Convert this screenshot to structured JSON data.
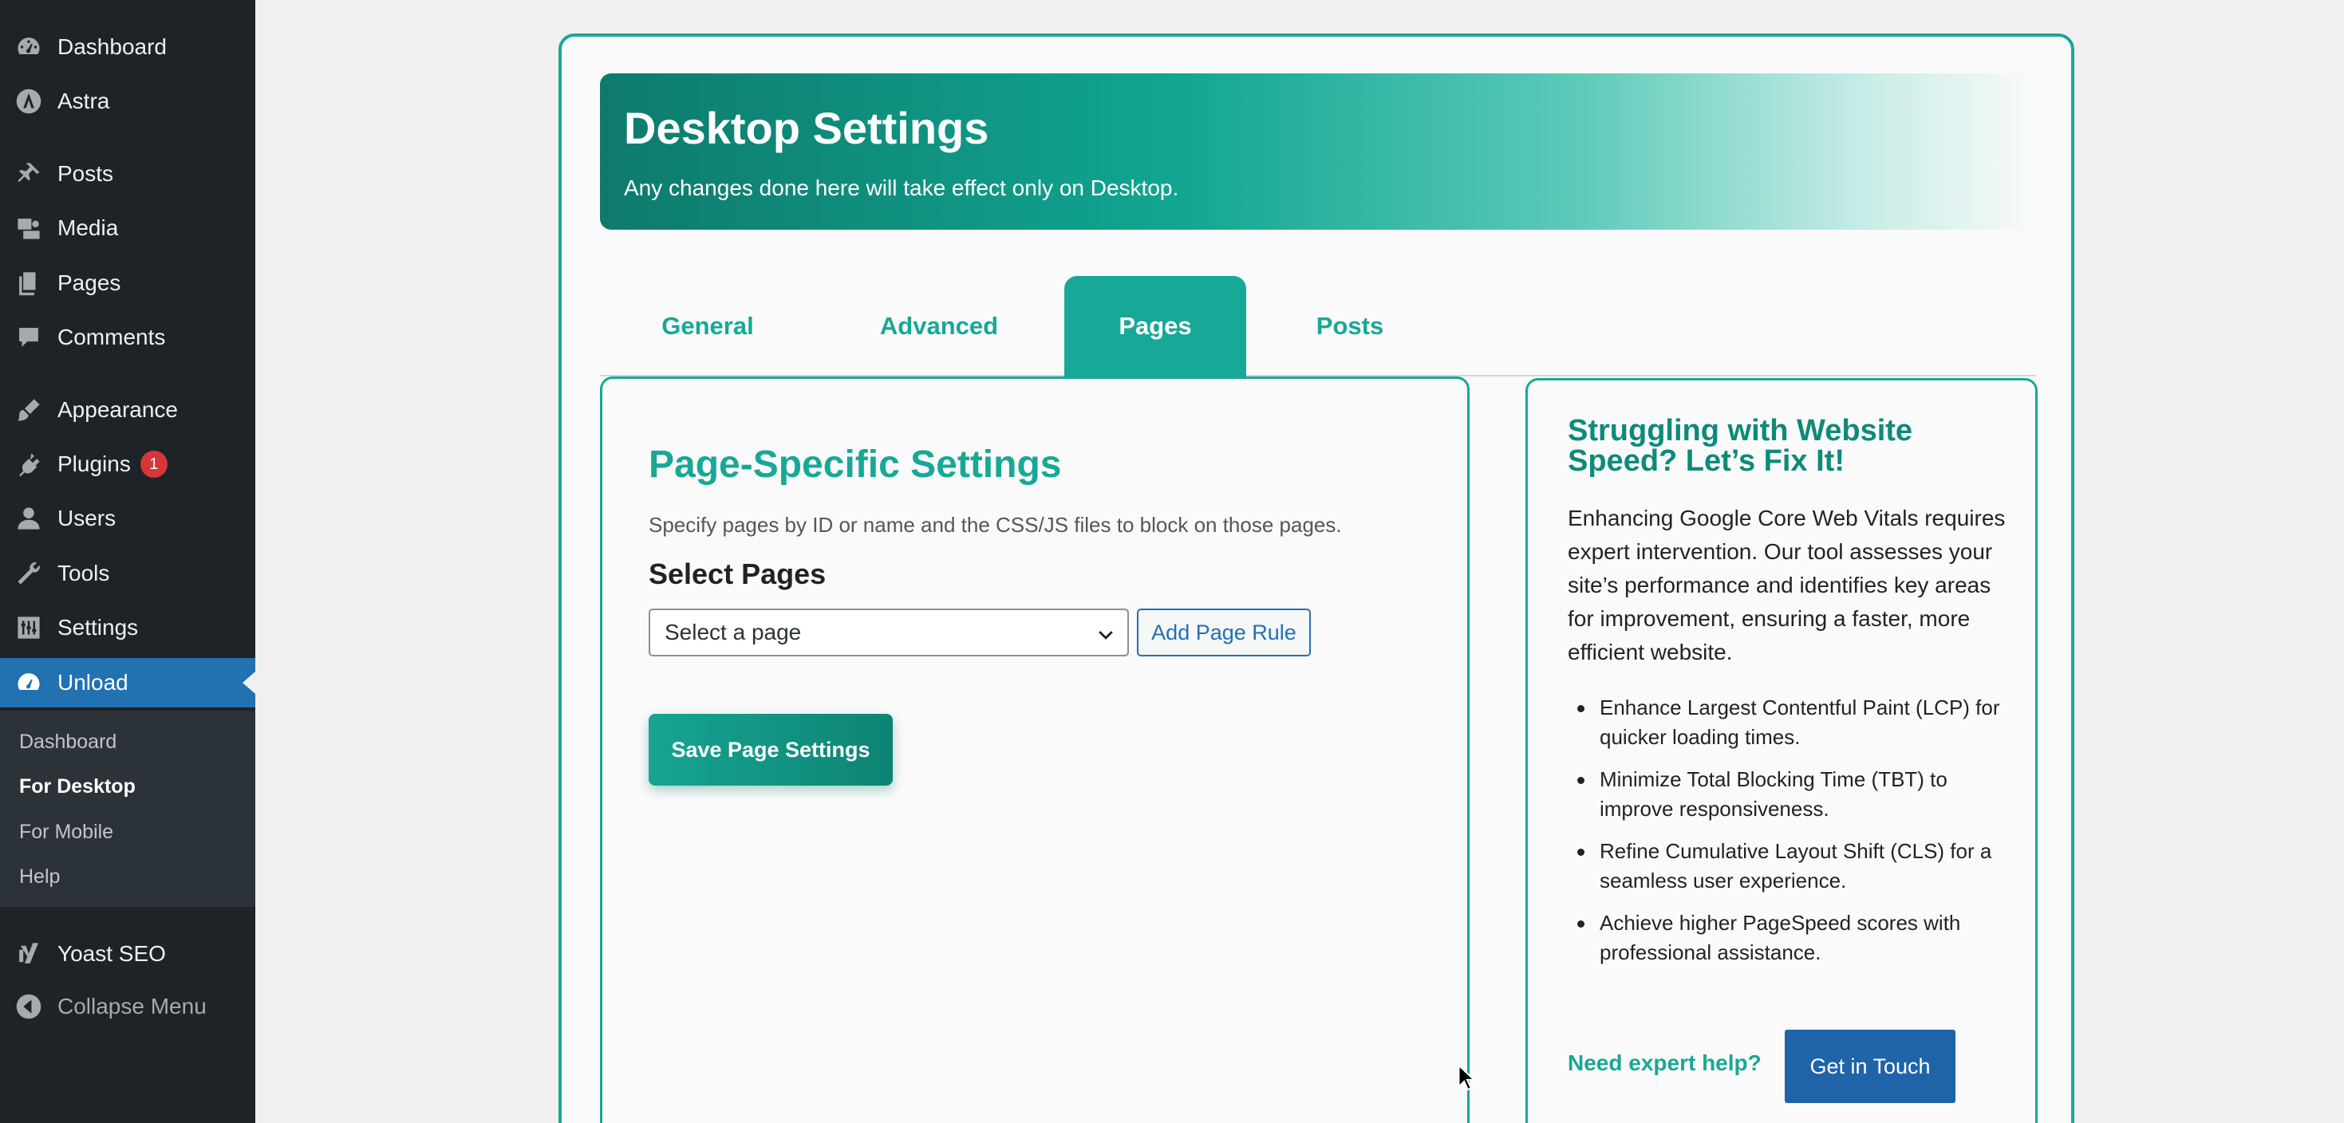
{
  "sidebar": {
    "items": [
      {
        "label": "Dashboard",
        "icon": "dashboard-icon"
      },
      {
        "label": "Astra",
        "icon": "astra-icon"
      },
      {
        "label": "Posts",
        "icon": "pin-icon"
      },
      {
        "label": "Media",
        "icon": "media-icon"
      },
      {
        "label": "Pages",
        "icon": "pages-icon"
      },
      {
        "label": "Comments",
        "icon": "comments-icon"
      },
      {
        "label": "Appearance",
        "icon": "brush-icon"
      },
      {
        "label": "Plugins",
        "icon": "plugin-icon",
        "badge": "1"
      },
      {
        "label": "Users",
        "icon": "user-icon"
      },
      {
        "label": "Tools",
        "icon": "wrench-icon"
      },
      {
        "label": "Settings",
        "icon": "settings-icon"
      },
      {
        "label": "Unload",
        "icon": "gauge-icon"
      },
      {
        "label": "Yoast SEO",
        "icon": "yoast-icon"
      },
      {
        "label": "Collapse Menu",
        "icon": "collapse-icon"
      }
    ],
    "submenu": [
      "Dashboard",
      "For Desktop",
      "For Mobile",
      "Help"
    ]
  },
  "hero": {
    "title": "Desktop Settings",
    "subtitle": "Any changes done here will take effect only on Desktop."
  },
  "tabs": [
    "General",
    "Advanced",
    "Pages",
    "Posts"
  ],
  "page_settings": {
    "title": "Page-Specific Settings",
    "description": "Specify pages by ID or name and the CSS/JS files to block on those pages.",
    "select_label": "Select Pages",
    "select_value": "Select a page",
    "add_rule": "Add Page Rule",
    "save": "Save Page Settings"
  },
  "promo": {
    "title": "Struggling with Website Speed? Let’s Fix It!",
    "text": "Enhancing Google Core Web Vitals requires expert intervention. Our tool assesses your site’s performance and identifies key areas for improvement, ensuring a faster, more efficient website.",
    "benefits": [
      "Enhance Largest Contentful Paint (LCP) for quicker loading times.",
      "Minimize Total Blocking Time (TBT) to improve responsiveness.",
      "Refine Cumulative Layout Shift (CLS) for a seamless user experience.",
      "Achieve higher PageSpeed scores with professional assistance."
    ],
    "expert": "Need expert help?",
    "cta": "Get in Touch"
  },
  "colors": {
    "accent": "#17a897",
    "sidebar": "#1d2327",
    "active": "#2271b1",
    "cta": "#1f63a8"
  }
}
